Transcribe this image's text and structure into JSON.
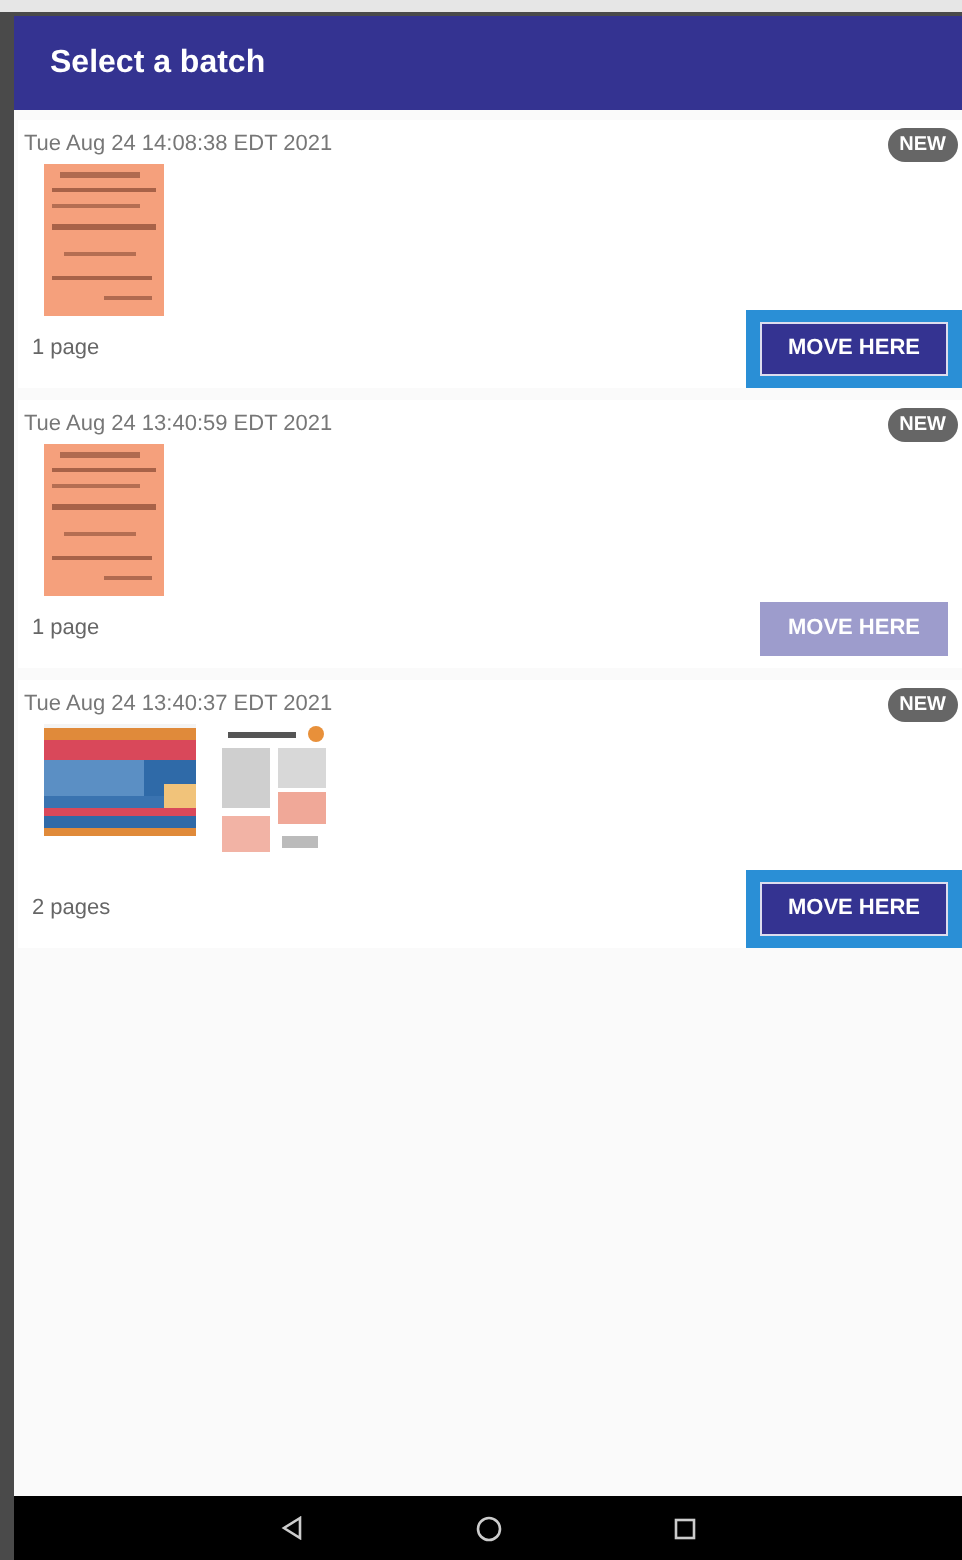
{
  "app_bar": {
    "title": "Select a batch"
  },
  "batches": [
    {
      "date": "Tue Aug 24 14:08:38 EDT 2021",
      "badge": "NEW",
      "pages": "1 page",
      "button": {
        "label": "MOVE HERE",
        "disabled": false,
        "focused": true
      }
    },
    {
      "date": "Tue Aug 24 13:40:59 EDT 2021",
      "badge": "NEW",
      "pages": "1 page",
      "button": {
        "label": "MOVE HERE",
        "disabled": true,
        "focused": false
      }
    },
    {
      "date": "Tue Aug 24 13:40:37 EDT 2021",
      "badge": "NEW",
      "pages": "2 pages",
      "button": {
        "label": "MOVE HERE",
        "disabled": false,
        "focused": true
      }
    }
  ]
}
